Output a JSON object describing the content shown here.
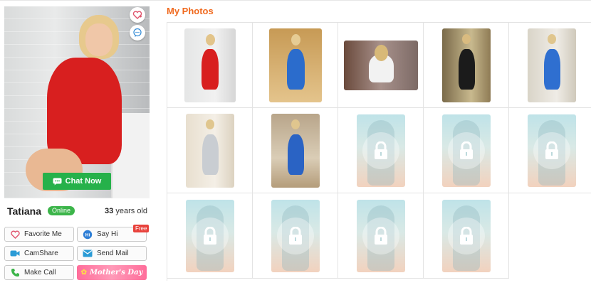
{
  "profile": {
    "watermark": "",
    "name": "Tatiana",
    "status": "Online",
    "age_number": "33",
    "age_suffix": "years old",
    "chat_label": "Chat Now",
    "icons": {
      "favorite_circle": "heart-plus-icon",
      "message_circle": "chat-bubble-icon"
    }
  },
  "actions": {
    "favorite": "Favorite Me",
    "say_hi": "Say Hi",
    "say_hi_badge": "Free",
    "camshare": "CamShare",
    "send_mail": "Send Mail",
    "make_call": "Make Call",
    "mothers_day": "Mother's Day"
  },
  "photos": {
    "title": "My Photos",
    "items": [
      {
        "locked": false,
        "scene": "red-dress-piano"
      },
      {
        "locked": false,
        "scene": "blue-dress-portrait"
      },
      {
        "locked": false,
        "scene": "white-top-sofa"
      },
      {
        "locked": false,
        "scene": "black-dress-room"
      },
      {
        "locked": false,
        "scene": "blue-dress-standing"
      },
      {
        "locked": false,
        "scene": "grey-dress-room"
      },
      {
        "locked": false,
        "scene": "blue-dress-hall"
      },
      {
        "locked": true
      },
      {
        "locked": true
      },
      {
        "locked": true
      },
      {
        "locked": true
      },
      {
        "locked": true
      },
      {
        "locked": true
      },
      {
        "locked": true
      }
    ]
  },
  "colors": {
    "accent_orange": "#f06a1f",
    "online_green": "#3cb54a",
    "chat_green": "#26b14a",
    "free_red": "#e8423c",
    "mothers_day_pink": "#ff7fa5"
  }
}
